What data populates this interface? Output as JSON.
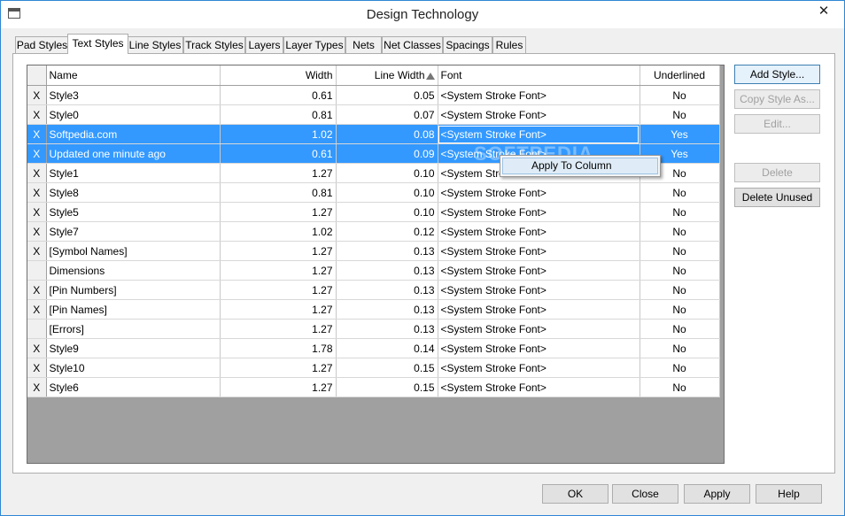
{
  "window": {
    "title": "Design Technology",
    "close_glyph": "✕"
  },
  "tabs": [
    {
      "label": "Pad Styles",
      "active": false
    },
    {
      "label": "Text Styles",
      "active": true
    },
    {
      "label": "Line Styles",
      "active": false
    },
    {
      "label": "Track Styles",
      "active": false
    },
    {
      "label": "Layers",
      "active": false
    },
    {
      "label": "Layer Types",
      "active": false
    },
    {
      "label": "Nets",
      "active": false
    },
    {
      "label": "Net Classes",
      "active": false
    },
    {
      "label": "Spacings",
      "active": false
    },
    {
      "label": "Rules",
      "active": false
    }
  ],
  "grid": {
    "columns": [
      "Name",
      "Width",
      "Line Width",
      "Font",
      "Underlined"
    ],
    "sorted_column": "Line Width",
    "sort_icon": "sort-ascending-icon",
    "rows": [
      {
        "mark": "X",
        "name": "Style3",
        "width": "0.61",
        "line_width": "0.05",
        "font": "<System Stroke Font>",
        "underlined": "No",
        "selected": false
      },
      {
        "mark": "X",
        "name": "Style0",
        "width": "0.81",
        "line_width": "0.07",
        "font": "<System Stroke Font>",
        "underlined": "No",
        "selected": false
      },
      {
        "mark": "X",
        "name": "Softpedia.com",
        "width": "1.02",
        "line_width": "0.08",
        "font": "<System Stroke Font>",
        "underlined": "Yes",
        "selected": true
      },
      {
        "mark": "X",
        "name": "Updated one minute ago",
        "width": "0.61",
        "line_width": "0.09",
        "font": "<System Stroke Font>",
        "underlined": "Yes",
        "selected": true
      },
      {
        "mark": "X",
        "name": "Style1",
        "width": "1.27",
        "line_width": "0.10",
        "font": "<System Stroke Font>",
        "underlined": "No",
        "selected": false
      },
      {
        "mark": "X",
        "name": "Style8",
        "width": "0.81",
        "line_width": "0.10",
        "font": "<System Stroke Font>",
        "underlined": "No",
        "selected": false
      },
      {
        "mark": "X",
        "name": "Style5",
        "width": "1.27",
        "line_width": "0.10",
        "font": "<System Stroke Font>",
        "underlined": "No",
        "selected": false
      },
      {
        "mark": "X",
        "name": "Style7",
        "width": "1.02",
        "line_width": "0.12",
        "font": "<System Stroke Font>",
        "underlined": "No",
        "selected": false
      },
      {
        "mark": "X",
        "name": "[Symbol Names]",
        "width": "1.27",
        "line_width": "0.13",
        "font": "<System Stroke Font>",
        "underlined": "No",
        "selected": false
      },
      {
        "mark": "",
        "name": "Dimensions",
        "width": "1.27",
        "line_width": "0.13",
        "font": "<System Stroke Font>",
        "underlined": "No",
        "selected": false
      },
      {
        "mark": "X",
        "name": "[Pin Numbers]",
        "width": "1.27",
        "line_width": "0.13",
        "font": "<System Stroke Font>",
        "underlined": "No",
        "selected": false
      },
      {
        "mark": "X",
        "name": "[Pin Names]",
        "width": "1.27",
        "line_width": "0.13",
        "font": "<System Stroke Font>",
        "underlined": "No",
        "selected": false
      },
      {
        "mark": "",
        "name": "[Errors]",
        "width": "1.27",
        "line_width": "0.13",
        "font": "<System Stroke Font>",
        "underlined": "No",
        "selected": false
      },
      {
        "mark": "X",
        "name": "Style9",
        "width": "1.78",
        "line_width": "0.14",
        "font": "<System Stroke Font>",
        "underlined": "No",
        "selected": false
      },
      {
        "mark": "X",
        "name": "Style10",
        "width": "1.27",
        "line_width": "0.15",
        "font": "<System Stroke Font>",
        "underlined": "No",
        "selected": false
      },
      {
        "mark": "X",
        "name": "Style6",
        "width": "1.27",
        "line_width": "0.15",
        "font": "<System Stroke Font>",
        "underlined": "No",
        "selected": false
      }
    ]
  },
  "context_menu": {
    "item": "Apply To Column"
  },
  "watermark": "SOFTPEDIA",
  "side_buttons": [
    {
      "label": "Add Style...",
      "enabled": true
    },
    {
      "label": "Copy Style As...",
      "enabled": false
    },
    {
      "label": "Edit...",
      "enabled": false
    },
    {
      "label": "Delete",
      "enabled": false
    },
    {
      "label": "Delete Unused",
      "enabled": true
    }
  ],
  "footer_buttons": [
    "OK",
    "Close",
    "Apply",
    "Help"
  ]
}
